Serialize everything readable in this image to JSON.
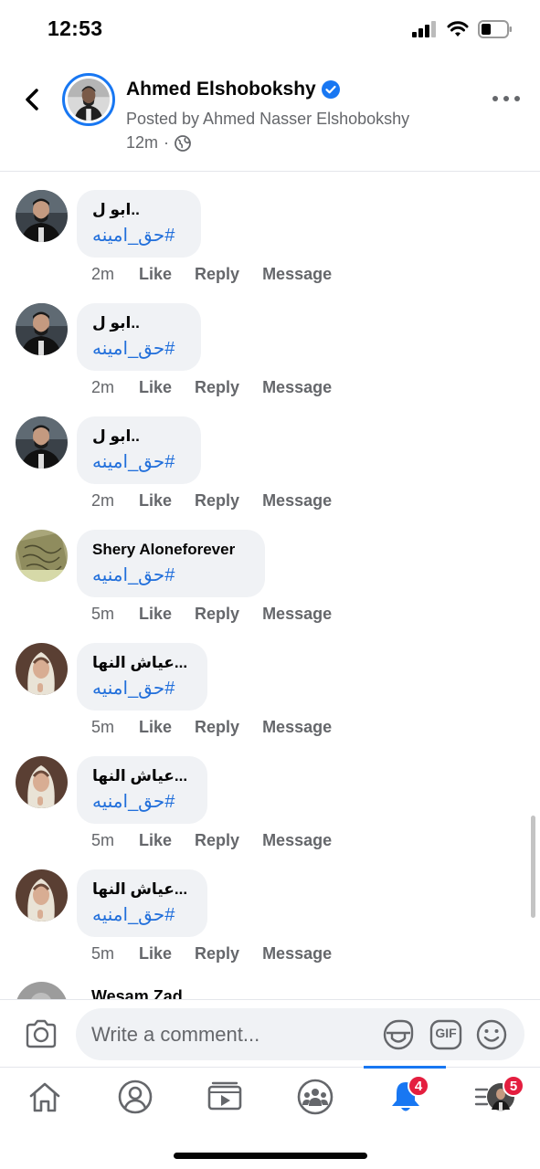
{
  "status_bar": {
    "time": "12:53"
  },
  "header": {
    "author_name": "Ahmed Elshobokshy",
    "posted_by": "Posted by Ahmed Nasser Elshobokshy",
    "time": "12m",
    "separator": "·"
  },
  "comments": [
    {
      "name": "ابو ل..",
      "hashtag": "#حق_امينه",
      "time": "2m",
      "like": "Like",
      "reply": "Reply",
      "message": "Message"
    },
    {
      "name": "ابو ل..",
      "hashtag": "#حق_امينه",
      "time": "2m",
      "like": "Like",
      "reply": "Reply",
      "message": "Message"
    },
    {
      "name": "ابو ل..",
      "hashtag": "#حق_امينه",
      "time": "2m",
      "like": "Like",
      "reply": "Reply",
      "message": "Message"
    },
    {
      "name": "Shery Aloneforever",
      "hashtag": "#حق_امنيه",
      "time": "5m",
      "like": "Like",
      "reply": "Reply",
      "message": "Message"
    },
    {
      "name": "عياش النها...",
      "hashtag": "#حق_امنيه",
      "time": "5m",
      "like": "Like",
      "reply": "Reply",
      "message": "Message"
    },
    {
      "name": "عياش النها...",
      "hashtag": "#حق_امنيه",
      "time": "5m",
      "like": "Like",
      "reply": "Reply",
      "message": "Message"
    },
    {
      "name": "عياش النها...",
      "hashtag": "#حق_امنيه",
      "time": "5m",
      "like": "Like",
      "reply": "Reply",
      "message": "Message"
    }
  ],
  "partial_comment": {
    "name": "Wesam Zad"
  },
  "composer": {
    "placeholder": "Write a comment...",
    "gif_label": "GIF"
  },
  "bottom_nav": {
    "notifications_badge": "4",
    "menu_badge": "5"
  },
  "colors": {
    "accent": "#1877f2",
    "hashtag": "#216fdb",
    "badge": "#e41e3f",
    "bubble": "#f0f2f5"
  }
}
